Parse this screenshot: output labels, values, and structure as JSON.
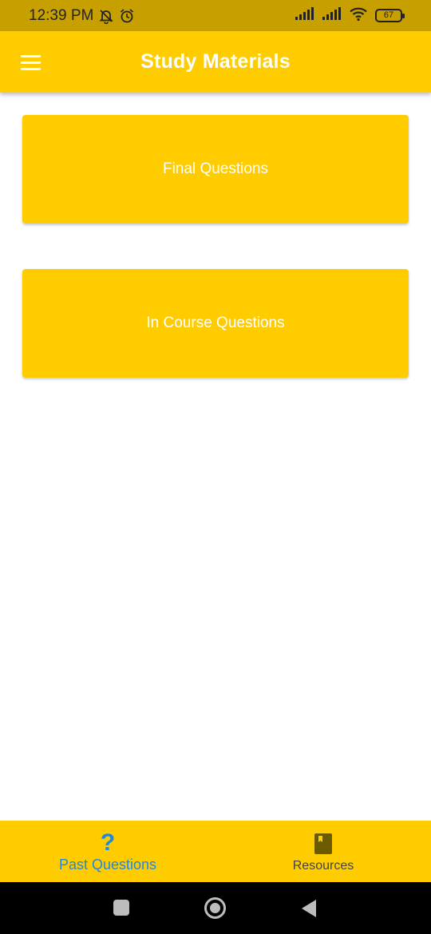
{
  "status_bar": {
    "time": "12:39 PM",
    "battery": "67",
    "icons": [
      "bell-off-icon",
      "alarm-icon",
      "signal-icon",
      "signal-icon",
      "wifi-icon",
      "battery-icon"
    ]
  },
  "app_bar": {
    "title": "Study Materials",
    "menu_icon": "hamburger-menu-icon"
  },
  "main": {
    "cards": [
      {
        "label": "Final Questions"
      },
      {
        "label": "In Course Questions"
      }
    ]
  },
  "bottom_nav": {
    "items": [
      {
        "label": "Past Questions",
        "icon": "question-icon",
        "active": true
      },
      {
        "label": "Resources",
        "icon": "book-icon",
        "active": false
      }
    ]
  },
  "colors": {
    "primary": "#ffcc00",
    "status_bar": "#c7a000",
    "active": "#1e88e5",
    "text_on_primary": "#ffffff"
  }
}
